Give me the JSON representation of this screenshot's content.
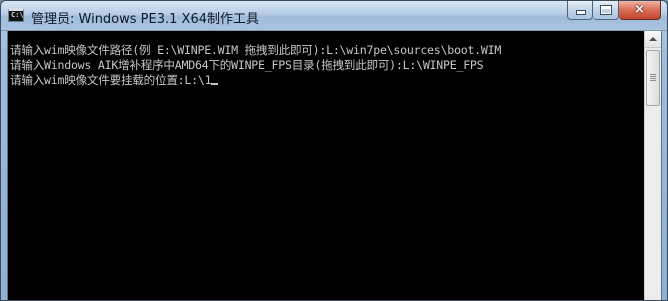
{
  "window": {
    "title": "管理员: Windows PE3.1 X64制作工具",
    "icon": "console-icon",
    "caption_buttons": {
      "minimize": "minimize-icon",
      "maximize": "maximize-icon",
      "close": "×"
    }
  },
  "console": {
    "lines": [
      "请输入wim映像文件路径(例 E:\\WINPE.WIM 拖拽到此即可):L:\\win7pe\\sources\\boot.WIM",
      "请输入Windows AIK增补程序中AMD64下的WINPE_FPS目录(拖拽到此即可):L:\\WINPE_FPS",
      "请输入wim映像文件要挂载的位置:L:\\1"
    ],
    "text_color": "#c6c6c6",
    "background_color": "#000000"
  }
}
